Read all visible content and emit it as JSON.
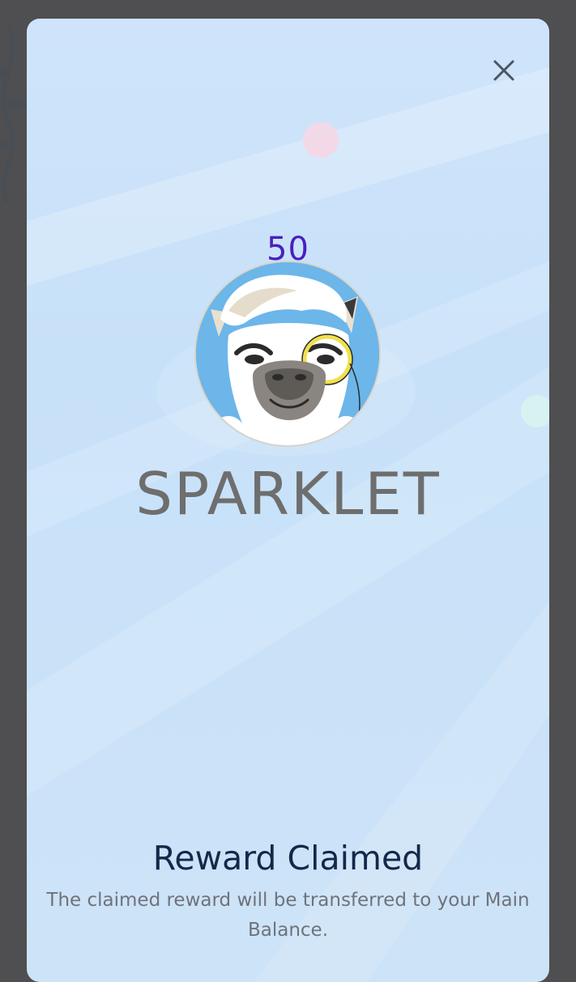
{
  "modal": {
    "close_icon": "close-icon",
    "reward_amount": "50",
    "token_image": "llama-with-monocle",
    "token_name": "SPARKLET",
    "title": "Reward Claimed",
    "description": "The claimed reward will be transferred to your Main Balance."
  },
  "colors": {
    "backdrop": "#4f4f51",
    "modal_bg": "#c9e2f9",
    "amount": "#4a1fc0",
    "token_name": "#6e6e6e",
    "title": "#13284a",
    "description": "#6f737a"
  }
}
